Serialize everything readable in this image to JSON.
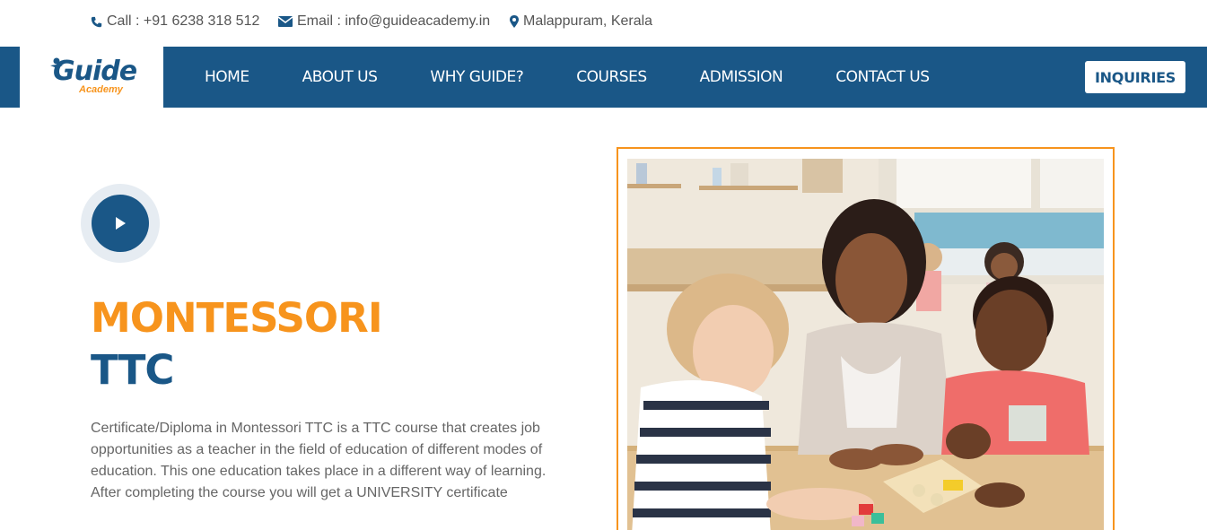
{
  "topbar": {
    "call": "Call : +91 6238 318 512",
    "email": "Email : info@guideacademy.in",
    "location": "Malappuram, Kerala"
  },
  "logo": {
    "word": "Guide",
    "sub": "Academy"
  },
  "nav": {
    "items": [
      {
        "label": "HOME"
      },
      {
        "label": "ABOUT US"
      },
      {
        "label": "WHY GUIDE?"
      },
      {
        "label": "COURSES"
      },
      {
        "label": "ADMISSION"
      },
      {
        "label": "CONTACT US"
      }
    ],
    "cta": "INQUIRIES"
  },
  "hero": {
    "title_line1": "MONTESSORI",
    "title_line2": "TTC",
    "description": "Certificate/Diploma in Montessori TTC is a TTC course that creates job opportunities as a teacher in the field of education of different modes of education. This one education takes place in a different way of learning. After completing the course you will get a UNIVERSITY certificate"
  },
  "colors": {
    "primary": "#1a5787",
    "accent": "#f7941d",
    "text": "#666666"
  },
  "icons": [
    "phone-icon",
    "envelope-icon",
    "map-marker-icon",
    "play-icon"
  ]
}
